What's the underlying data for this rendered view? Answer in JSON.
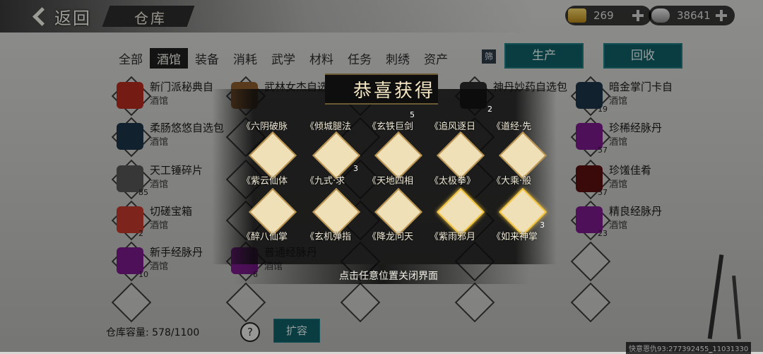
{
  "header": {
    "back_label": "返回",
    "title": "仓库",
    "gold_value": "269",
    "silver_value": "38641"
  },
  "tabs": [
    "全部",
    "酒馆",
    "装备",
    "消耗",
    "武学",
    "材料",
    "任务",
    "刺绣",
    "资产"
  ],
  "active_tab_index": 1,
  "filter_label": "筛",
  "actions": {
    "produce": "生产",
    "recycle": "回收"
  },
  "items": [
    {
      "name": "新门派秘典自",
      "cat": "酒馆",
      "color": "#b22a20"
    },
    {
      "name": "武林女杰自选",
      "cat": "",
      "color": "#8b5a2b"
    },
    {
      "name": "神丹妙药自选包",
      "cat": "",
      "color": "#2a2a2a"
    },
    {
      "name": "暗金掌门卡自",
      "cat": "酒馆",
      "count": "19",
      "color": "#1b3345"
    },
    {
      "name": "柔肠悠悠自选包",
      "cat": "酒馆",
      "color": "#1b3345"
    },
    {
      "name": "珍稀经脉丹",
      "cat": "酒馆",
      "count": "57",
      "color": "#7a1a8a"
    },
    {
      "name": "天工锤碎片",
      "cat": "酒馆",
      "count": "85",
      "color": "#555555"
    },
    {
      "name": "珍馐佳肴",
      "cat": "酒馆",
      "count": "57",
      "color": "#5a1010"
    },
    {
      "name": "切磋宝箱",
      "cat": "酒馆",
      "count": "2",
      "color": "#c0392b"
    },
    {
      "name": "精良经脉丹",
      "cat": "酒馆",
      "count": "23",
      "color": "#7a1a8a"
    },
    {
      "name": "新手经脉丹",
      "cat": "酒馆",
      "count": "10",
      "color": "#7a1a8a"
    },
    {
      "name": "普通经脉丹",
      "cat": "酒馆",
      "count": "6",
      "color": "#7a1a8a"
    }
  ],
  "popup": {
    "title": "恭喜获得",
    "rewards_row1": [
      "《六阴破脉",
      "《倾城腿法",
      "《玄铁巨剑",
      "《追风逐日",
      "《道经·先"
    ],
    "rewards_row1_extra": [
      "5",
      "2"
    ],
    "rewards_row2": [
      "《紫云仙体",
      "《九式·求",
      "《天地四相",
      "《太极拳》",
      "《大乘·般"
    ],
    "rewards_row2_counts": [
      "",
      "3",
      "",
      "",
      ""
    ],
    "rewards_row3": [
      "《醉八仙掌",
      "《玄机弹指",
      "《降龙问天",
      "《紫雨邪月",
      "《如来神掌"
    ],
    "rewards_row3_counts": [
      "",
      "",
      "",
      "",
      "3"
    ],
    "close_hint": "点击任意位置关闭界面"
  },
  "footer": {
    "capacity_label": "仓库容量:",
    "capacity_value": "578/1100",
    "help_label": "?",
    "expand_label": "扩容",
    "id_text": "快意恩仇93:277392455_11031330"
  }
}
